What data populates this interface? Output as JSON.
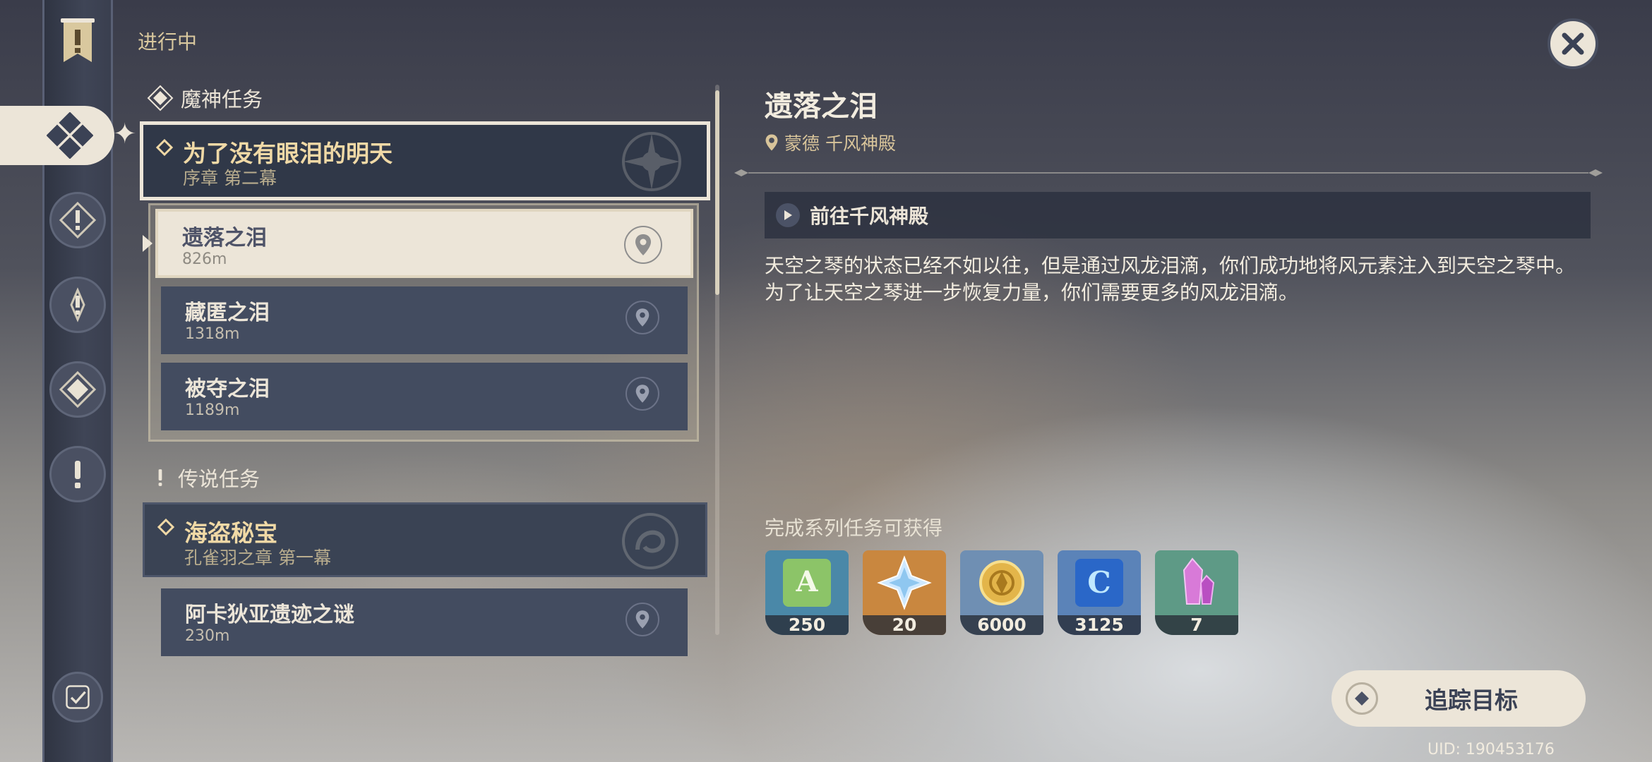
{
  "header": {
    "section_label": "进行中"
  },
  "categories": {
    "archon": "魔神任务",
    "story": "传说任务"
  },
  "chapters": [
    {
      "title": "为了没有眼泪的明天",
      "subtitle": "序章 第二幕"
    },
    {
      "title": "海盗秘宝",
      "subtitle": "孔雀羽之章 第一幕"
    }
  ],
  "quests": [
    {
      "name": "遗落之泪",
      "distance": "826m",
      "selected": true
    },
    {
      "name": "藏匿之泪",
      "distance": "1318m"
    },
    {
      "name": "被夺之泪",
      "distance": "1189m"
    },
    {
      "name": "阿卡狄亚遗迹之谜",
      "distance": "230m"
    }
  ],
  "detail": {
    "title": "遗落之泪",
    "location": "蒙德 千风神殿",
    "objective": "前往千风神殿",
    "description": "天空之琴的状态已经不如以往，但是通过风龙泪滴，你们成功地将风元素注入到天空之琴中。为了让天空之琴进一步恢复力量，你们需要更多的风龙泪滴。"
  },
  "rewards": {
    "heading": "完成系列任务可获得",
    "items": [
      {
        "icon": "adventure-exp-icon",
        "count": "250",
        "bg": "#4a88a8"
      },
      {
        "icon": "primogem-icon",
        "count": "20",
        "bg": "#c9873f"
      },
      {
        "icon": "mora-icon",
        "count": "6000",
        "bg": "#6f8fb3"
      },
      {
        "icon": "companionship-exp-icon",
        "count": "3125",
        "bg": "#5b83b8"
      },
      {
        "icon": "crystal-icon",
        "count": "7",
        "bg": "#5e9a86"
      }
    ]
  },
  "actions": {
    "track_label": "追踪目标"
  },
  "footer": {
    "uid": "UID: 190453176"
  },
  "colors": {
    "accent_cream": "#ece5d8",
    "gold_text": "#f0d9a6",
    "panel_dark": "#303848"
  }
}
